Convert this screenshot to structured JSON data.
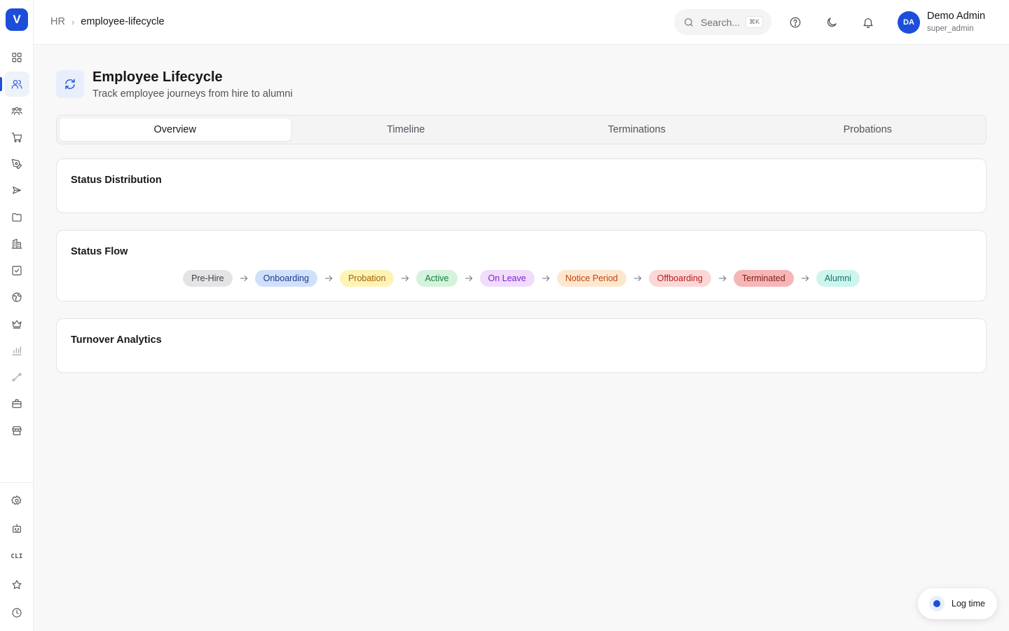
{
  "app": {
    "logo_letter": "V"
  },
  "sidebar": {
    "items": [
      {
        "name": "dashboard-icon",
        "label": "Dashboard"
      },
      {
        "name": "users-icon",
        "label": "HR"
      },
      {
        "name": "team-icon",
        "label": "People"
      },
      {
        "name": "cart-icon",
        "label": "Commerce"
      },
      {
        "name": "pen-icon",
        "label": "Design"
      },
      {
        "name": "send-icon",
        "label": "Marketing"
      },
      {
        "name": "folder-icon",
        "label": "Files"
      },
      {
        "name": "building-icon",
        "label": "Company"
      },
      {
        "name": "checkbox-icon",
        "label": "Tasks"
      },
      {
        "name": "globe-icon",
        "label": "Web"
      },
      {
        "name": "crown-icon",
        "label": "Premium"
      },
      {
        "name": "bar-chart-icon",
        "label": "Analytics"
      },
      {
        "name": "route-icon",
        "label": "Routes"
      },
      {
        "name": "briefcase-icon",
        "label": "Jobs"
      },
      {
        "name": "store-icon",
        "label": "Store"
      }
    ],
    "bottom_items": [
      {
        "name": "settings-icon",
        "label": "Settings"
      },
      {
        "name": "bot-icon",
        "label": "Bot"
      },
      {
        "name": "cli-icon",
        "label": "CLI"
      },
      {
        "name": "star-icon",
        "label": "Favorites"
      },
      {
        "name": "clock-icon",
        "label": "History"
      }
    ],
    "cli_text": "CLI"
  },
  "header": {
    "breadcrumb_root": "HR",
    "breadcrumb_separator": "›",
    "breadcrumb_current": "employee-lifecycle",
    "search_placeholder": "Search...",
    "search_shortcut": "⌘K",
    "user": {
      "initials": "DA",
      "name": "Demo Admin",
      "role": "super_admin"
    }
  },
  "page": {
    "title": "Employee Lifecycle",
    "subtitle": "Track employee journeys from hire to alumni"
  },
  "tabs": [
    {
      "label": "Overview",
      "active": true
    },
    {
      "label": "Timeline",
      "active": false
    },
    {
      "label": "Terminations",
      "active": false
    },
    {
      "label": "Probations",
      "active": false
    }
  ],
  "cards": {
    "status_distribution": {
      "title": "Status Distribution"
    },
    "status_flow": {
      "title": "Status Flow",
      "steps": [
        {
          "label": "Pre-Hire",
          "bg": "#e4e4e7",
          "fg": "#3f3f46"
        },
        {
          "label": "Onboarding",
          "bg": "#cfe0fb",
          "fg": "#1e3a8a"
        },
        {
          "label": "Probation",
          "bg": "#fdf3b4",
          "fg": "#a16207"
        },
        {
          "label": "Active",
          "bg": "#d4f2dc",
          "fg": "#15803d"
        },
        {
          "label": "On Leave",
          "bg": "#f0dcfb",
          "fg": "#7e22ce"
        },
        {
          "label": "Notice Period",
          "bg": "#fde8cf",
          "fg": "#c2410c"
        },
        {
          "label": "Offboarding",
          "bg": "#fbd8d8",
          "fg": "#b91c1c"
        },
        {
          "label": "Terminated",
          "bg": "#f6b6b6",
          "fg": "#7f1d1d"
        },
        {
          "label": "Alumni",
          "bg": "#cdf5ec",
          "fg": "#0f766e"
        }
      ]
    },
    "turnover_analytics": {
      "title": "Turnover Analytics"
    }
  },
  "log_time": {
    "label": "Log time"
  },
  "colors": {
    "accent": "#1d4ed8",
    "background": "#f8f8f9"
  }
}
